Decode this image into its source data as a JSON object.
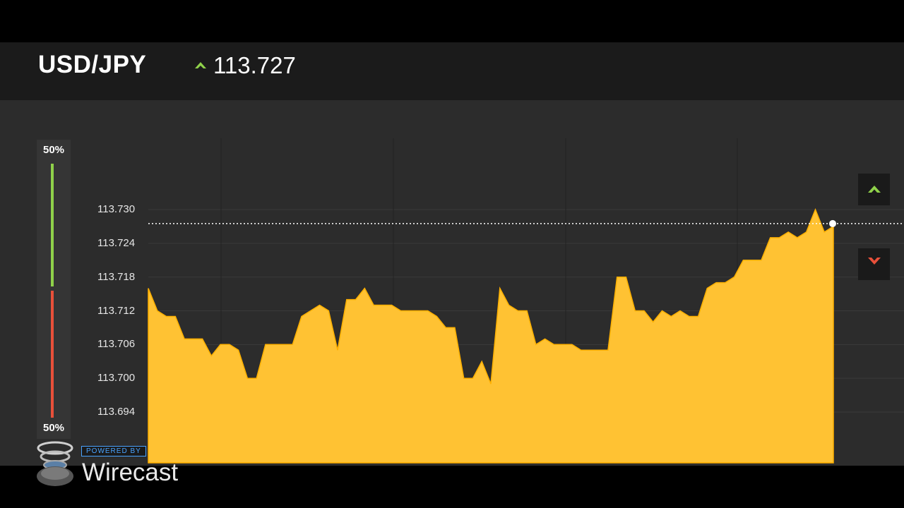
{
  "header": {
    "pair": "USD/JPY",
    "price": "113.727",
    "trend": "up"
  },
  "sentiment": {
    "top_label": "50%",
    "bottom_label": "50%",
    "buy_fraction": 0.5,
    "sell_fraction": 0.5,
    "buy_color": "#8fd14a",
    "sell_color": "#e8503a"
  },
  "chart_data": {
    "type": "area",
    "series_color": "#ffc233",
    "current_value": 113.727,
    "y_ticks": [
      "113.730",
      "113.724",
      "113.718",
      "113.712",
      "113.706",
      "113.700",
      "113.694"
    ],
    "values": [
      113.716,
      113.712,
      113.711,
      113.711,
      113.707,
      113.707,
      113.707,
      113.704,
      113.706,
      113.706,
      113.705,
      113.7,
      113.7,
      113.706,
      113.706,
      113.706,
      113.706,
      113.711,
      113.712,
      113.713,
      113.712,
      113.705,
      113.714,
      113.714,
      113.716,
      113.713,
      113.713,
      113.713,
      113.712,
      113.712,
      113.712,
      113.712,
      113.711,
      113.709,
      113.709,
      113.7,
      113.7,
      113.703,
      113.699,
      113.716,
      113.713,
      113.712,
      113.712,
      113.706,
      113.707,
      113.706,
      113.706,
      113.706,
      113.705,
      113.705,
      113.705,
      113.705,
      113.718,
      113.718,
      113.712,
      113.712,
      113.71,
      113.712,
      113.711,
      113.712,
      113.711,
      113.711,
      113.716,
      113.717,
      113.717,
      113.718,
      113.721,
      113.721,
      113.721,
      113.725,
      113.725,
      113.726,
      113.725,
      113.726,
      113.73,
      113.726,
      113.727
    ]
  },
  "controls": {
    "buy_icon": "up-chevron-icon",
    "sell_icon": "down-chevron-icon"
  },
  "watermark": {
    "powered_by": "POWERED BY",
    "brand": "Wirecast"
  }
}
